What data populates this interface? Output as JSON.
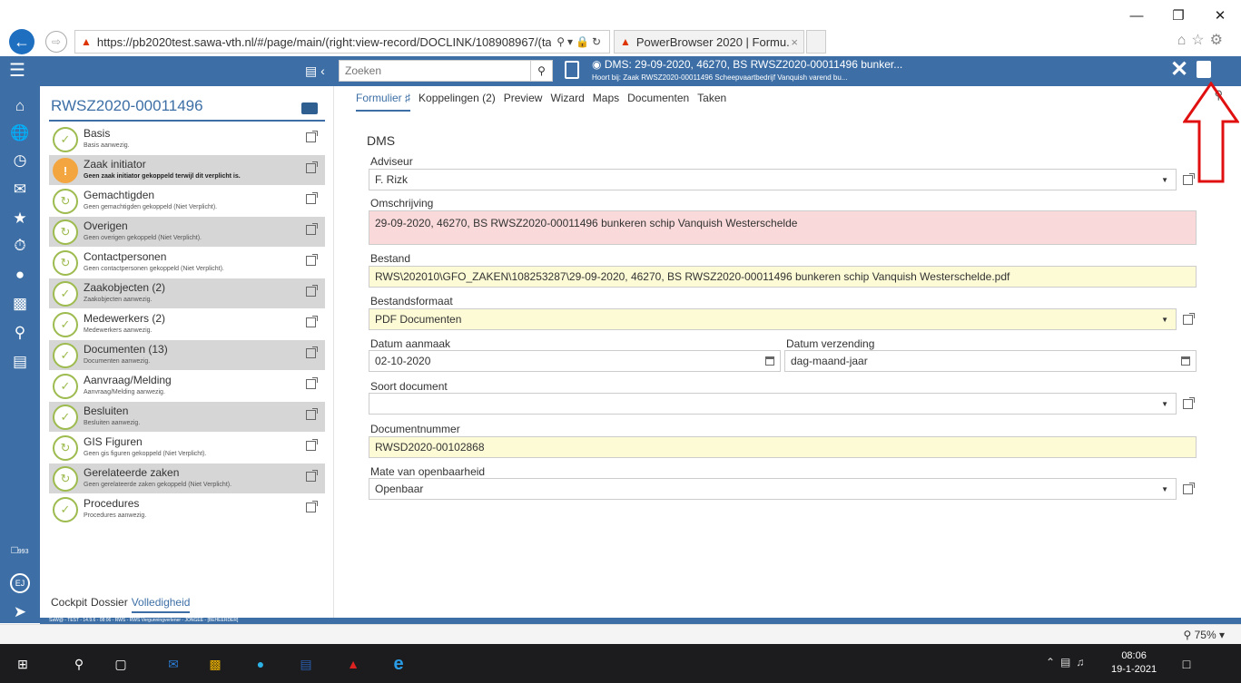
{
  "browser": {
    "address": "https://pb2020test.sawa-vth.nl/#/page/main/(right:view-record/DOCLINK/108908967/(ta",
    "tab_title": "PowerBrowser 2020 | Formu...",
    "tab_close": "×",
    "win_minimize": "—",
    "win_restore": "❐",
    "win_close": "✕"
  },
  "header": {
    "search_placeholder": "Zoeken",
    "record_title": "DMS: 29-09-2020, 46270, BS RWSZ2020-00011496 bunker...",
    "record_subtitle": "Hoort bij: Zaak RWSZ2020-00011496 Scheepvaartbedrijf Vanquish varend bu...",
    "close_label": "✕"
  },
  "case": {
    "title": "RWSZ2020-00011496"
  },
  "items": [
    {
      "name": "Basis",
      "desc": "Basis aanwezig.",
      "status": "ok",
      "shaded": false,
      "bold": false
    },
    {
      "name": "Zaak initiator",
      "desc": "Geen zaak initiator gekoppeld terwijl dit verplicht is.",
      "status": "warn",
      "shaded": true,
      "bold": true
    },
    {
      "name": "Gemachtigden",
      "desc": "Geen gemachtigden gekoppeld (Niet Verplicht).",
      "status": "partial",
      "shaded": false,
      "bold": false
    },
    {
      "name": "Overigen",
      "desc": "Geen overigen gekoppeld (Niet Verplicht).",
      "status": "partial",
      "shaded": true,
      "bold": false
    },
    {
      "name": "Contactpersonen",
      "desc": "Geen contactpersonen gekoppeld (Niet Verplicht).",
      "status": "partial",
      "shaded": false,
      "bold": false
    },
    {
      "name": "Zaakobjecten (2)",
      "desc": "Zaakobjecten aanwezig.",
      "status": "ok",
      "shaded": true,
      "bold": false
    },
    {
      "name": "Medewerkers (2)",
      "desc": "Medewerkers aanwezig.",
      "status": "ok",
      "shaded": false,
      "bold": false
    },
    {
      "name": "Documenten (13)",
      "desc": "Documenten aanwezig.",
      "status": "ok",
      "shaded": true,
      "bold": false
    },
    {
      "name": "Aanvraag/Melding",
      "desc": "Aanvraag/Melding aanwezig.",
      "status": "ok",
      "shaded": false,
      "bold": false
    },
    {
      "name": "Besluiten",
      "desc": "Besluiten aanwezig.",
      "status": "ok",
      "shaded": true,
      "bold": false
    },
    {
      "name": "GIS Figuren",
      "desc": "Geen gis figuren gekoppeld (Niet Verplicht).",
      "status": "partial",
      "shaded": false,
      "bold": false
    },
    {
      "name": "Gerelateerde zaken",
      "desc": "Geen gerelateerde zaken gekoppeld (Niet Verplicht).",
      "status": "partial",
      "shaded": true,
      "bold": false
    },
    {
      "name": "Procedures",
      "desc": "Procedures aanwezig.",
      "status": "ok",
      "shaded": false,
      "bold": false
    }
  ],
  "left_tabs": [
    "Cockpit",
    "Dossier",
    "Volledigheid"
  ],
  "main_tabs": [
    "Formulier",
    "Koppelingen (2)",
    "Preview",
    "Wizard",
    "Maps",
    "Documenten",
    "Taken"
  ],
  "form": {
    "title": "DMS",
    "adviseur_label": "Adviseur",
    "adviseur_value": "F. Rizk",
    "omschrijving_label": "Omschrijving",
    "omschrijving_value": "29-09-2020, 46270, BS RWSZ2020-00011496 bunkeren schip Vanquish Westerschelde",
    "bestand_label": "Bestand",
    "bestand_value": "RWS\\202010\\GFO_ZAKEN\\108253287\\29-09-2020, 46270, BS RWSZ2020-00011496 bunkeren schip Vanquish Westerschelde.pdf",
    "bestandsformaat_label": "Bestandsformaat",
    "bestandsformaat_value": "PDF Documenten",
    "datum_aanmaak_label": "Datum aanmaak",
    "datum_aanmaak_value": "02-10-2020",
    "datum_verzending_label": "Datum verzending",
    "datum_verzending_placeholder": "dag-maand-jaar",
    "soort_document_label": "Soort document",
    "soort_document_value": "",
    "documentnummer_label": "Documentnummer",
    "documentnummer_value": "RWSD2020-00102868",
    "openbaarheid_label": "Mate van openbaarheid",
    "openbaarheid_value": "Openbaar"
  },
  "status_strip": "SaW@ - TEST - 14.9.6 - 08:06 - RWS - RWS Vergunningverlener - JONGEE - [BEHEERDER]",
  "zoom_level": "75%",
  "rail_badge": "993",
  "avatar_initials": "EJ",
  "taskbar": {
    "time": "08:06",
    "date": "19-1-2021"
  }
}
